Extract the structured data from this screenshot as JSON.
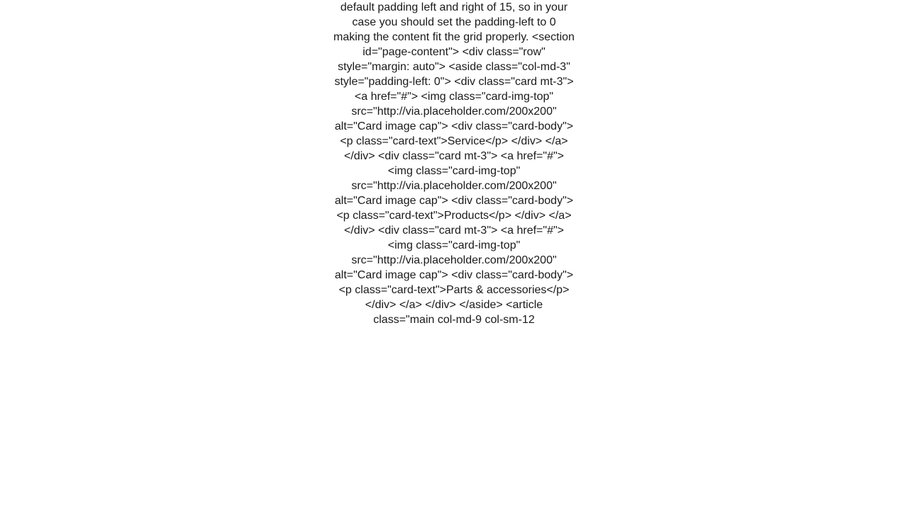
{
  "body_text": "default padding left and right of 15, so in your case you should set the padding-left to 0 making the content fit the grid properly. <section id=\"page-content\">   <div class=\"row\" style=\"margin: auto\">     <aside class=\"col-md-3\" style=\"padding-left: 0\">       <div class=\"card mt-3\">         <a href=\"#\">           <img class=\"card-img-top\" src=\"http://via.placeholder.com/200x200\" alt=\"Card image cap\">           <div class=\"card-body\">             <p class=\"card-text\">Service</p>           </div>         </a>       </div>       <div class=\"card mt-3\">         <a href=\"#\">           <img class=\"card-img-top\" src=\"http://via.placeholder.com/200x200\" alt=\"Card image cap\">           <div class=\"card-body\">             <p class=\"card-text\">Products</p>           </div>         </a>       </div>       <div class=\"card mt-3\">         <a href=\"#\">           <img class=\"card-img-top\" src=\"http://via.placeholder.com/200x200\" alt=\"Card image cap\">           <div class=\"card-body\">             <p class=\"card-text\">Parts & accessories</p>           </div>         </a>       </div>     </aside>     <article class=\"main col-md-9 col-sm-12"
}
